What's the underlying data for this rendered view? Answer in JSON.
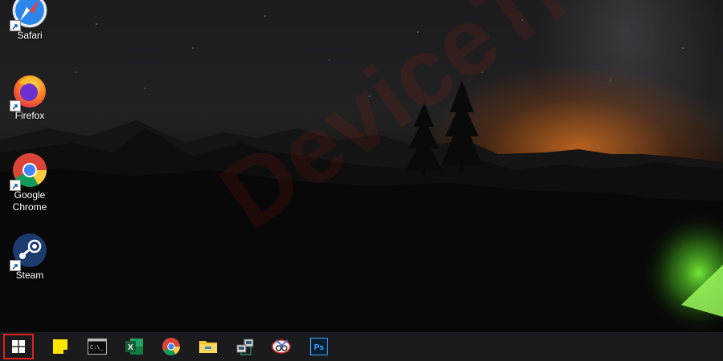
{
  "desktop": {
    "watermark": "DeviceTricks",
    "icons": [
      {
        "label": "Safari",
        "icon": "safari-icon"
      },
      {
        "label": "Firefox",
        "icon": "firefox-icon"
      },
      {
        "label": "Google Chrome",
        "icon": "chrome-icon"
      },
      {
        "label": "Steam",
        "icon": "steam-icon"
      }
    ]
  },
  "taskbar": {
    "start_highlight_color": "#e02020",
    "items": [
      {
        "icon": "windows-start-icon"
      },
      {
        "icon": "sticky-notes-icon"
      },
      {
        "icon": "command-prompt-icon"
      },
      {
        "icon": "excel-icon"
      },
      {
        "icon": "chrome-icon"
      },
      {
        "icon": "file-explorer-icon"
      },
      {
        "icon": "network-connections-icon"
      },
      {
        "icon": "snipping-tool-icon"
      },
      {
        "icon": "photoshop-icon"
      }
    ],
    "excel_letter": "X",
    "photoshop_letters": "Ps",
    "cmd_prompt_text": "C:\\_"
  }
}
